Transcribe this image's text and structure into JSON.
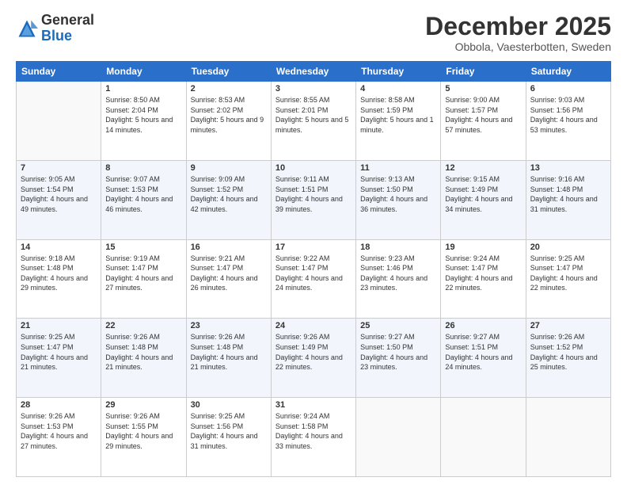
{
  "header": {
    "logo_general": "General",
    "logo_blue": "Blue",
    "month_title": "December 2025",
    "subtitle": "Obbola, Vaesterbotten, Sweden"
  },
  "days_of_week": [
    "Sunday",
    "Monday",
    "Tuesday",
    "Wednesday",
    "Thursday",
    "Friday",
    "Saturday"
  ],
  "weeks": [
    [
      {
        "day": "",
        "sunrise": "",
        "sunset": "",
        "daylight": ""
      },
      {
        "day": "1",
        "sunrise": "Sunrise: 8:50 AM",
        "sunset": "Sunset: 2:04 PM",
        "daylight": "Daylight: 5 hours and 14 minutes."
      },
      {
        "day": "2",
        "sunrise": "Sunrise: 8:53 AM",
        "sunset": "Sunset: 2:02 PM",
        "daylight": "Daylight: 5 hours and 9 minutes."
      },
      {
        "day": "3",
        "sunrise": "Sunrise: 8:55 AM",
        "sunset": "Sunset: 2:01 PM",
        "daylight": "Daylight: 5 hours and 5 minutes."
      },
      {
        "day": "4",
        "sunrise": "Sunrise: 8:58 AM",
        "sunset": "Sunset: 1:59 PM",
        "daylight": "Daylight: 5 hours and 1 minute."
      },
      {
        "day": "5",
        "sunrise": "Sunrise: 9:00 AM",
        "sunset": "Sunset: 1:57 PM",
        "daylight": "Daylight: 4 hours and 57 minutes."
      },
      {
        "day": "6",
        "sunrise": "Sunrise: 9:03 AM",
        "sunset": "Sunset: 1:56 PM",
        "daylight": "Daylight: 4 hours and 53 minutes."
      }
    ],
    [
      {
        "day": "7",
        "sunrise": "Sunrise: 9:05 AM",
        "sunset": "Sunset: 1:54 PM",
        "daylight": "Daylight: 4 hours and 49 minutes."
      },
      {
        "day": "8",
        "sunrise": "Sunrise: 9:07 AM",
        "sunset": "Sunset: 1:53 PM",
        "daylight": "Daylight: 4 hours and 46 minutes."
      },
      {
        "day": "9",
        "sunrise": "Sunrise: 9:09 AM",
        "sunset": "Sunset: 1:52 PM",
        "daylight": "Daylight: 4 hours and 42 minutes."
      },
      {
        "day": "10",
        "sunrise": "Sunrise: 9:11 AM",
        "sunset": "Sunset: 1:51 PM",
        "daylight": "Daylight: 4 hours and 39 minutes."
      },
      {
        "day": "11",
        "sunrise": "Sunrise: 9:13 AM",
        "sunset": "Sunset: 1:50 PM",
        "daylight": "Daylight: 4 hours and 36 minutes."
      },
      {
        "day": "12",
        "sunrise": "Sunrise: 9:15 AM",
        "sunset": "Sunset: 1:49 PM",
        "daylight": "Daylight: 4 hours and 34 minutes."
      },
      {
        "day": "13",
        "sunrise": "Sunrise: 9:16 AM",
        "sunset": "Sunset: 1:48 PM",
        "daylight": "Daylight: 4 hours and 31 minutes."
      }
    ],
    [
      {
        "day": "14",
        "sunrise": "Sunrise: 9:18 AM",
        "sunset": "Sunset: 1:48 PM",
        "daylight": "Daylight: 4 hours and 29 minutes."
      },
      {
        "day": "15",
        "sunrise": "Sunrise: 9:19 AM",
        "sunset": "Sunset: 1:47 PM",
        "daylight": "Daylight: 4 hours and 27 minutes."
      },
      {
        "day": "16",
        "sunrise": "Sunrise: 9:21 AM",
        "sunset": "Sunset: 1:47 PM",
        "daylight": "Daylight: 4 hours and 26 minutes."
      },
      {
        "day": "17",
        "sunrise": "Sunrise: 9:22 AM",
        "sunset": "Sunset: 1:47 PM",
        "daylight": "Daylight: 4 hours and 24 minutes."
      },
      {
        "day": "18",
        "sunrise": "Sunrise: 9:23 AM",
        "sunset": "Sunset: 1:46 PM",
        "daylight": "Daylight: 4 hours and 23 minutes."
      },
      {
        "day": "19",
        "sunrise": "Sunrise: 9:24 AM",
        "sunset": "Sunset: 1:47 PM",
        "daylight": "Daylight: 4 hours and 22 minutes."
      },
      {
        "day": "20",
        "sunrise": "Sunrise: 9:25 AM",
        "sunset": "Sunset: 1:47 PM",
        "daylight": "Daylight: 4 hours and 22 minutes."
      }
    ],
    [
      {
        "day": "21",
        "sunrise": "Sunrise: 9:25 AM",
        "sunset": "Sunset: 1:47 PM",
        "daylight": "Daylight: 4 hours and 21 minutes."
      },
      {
        "day": "22",
        "sunrise": "Sunrise: 9:26 AM",
        "sunset": "Sunset: 1:48 PM",
        "daylight": "Daylight: 4 hours and 21 minutes."
      },
      {
        "day": "23",
        "sunrise": "Sunrise: 9:26 AM",
        "sunset": "Sunset: 1:48 PM",
        "daylight": "Daylight: 4 hours and 21 minutes."
      },
      {
        "day": "24",
        "sunrise": "Sunrise: 9:26 AM",
        "sunset": "Sunset: 1:49 PM",
        "daylight": "Daylight: 4 hours and 22 minutes."
      },
      {
        "day": "25",
        "sunrise": "Sunrise: 9:27 AM",
        "sunset": "Sunset: 1:50 PM",
        "daylight": "Daylight: 4 hours and 23 minutes."
      },
      {
        "day": "26",
        "sunrise": "Sunrise: 9:27 AM",
        "sunset": "Sunset: 1:51 PM",
        "daylight": "Daylight: 4 hours and 24 minutes."
      },
      {
        "day": "27",
        "sunrise": "Sunrise: 9:26 AM",
        "sunset": "Sunset: 1:52 PM",
        "daylight": "Daylight: 4 hours and 25 minutes."
      }
    ],
    [
      {
        "day": "28",
        "sunrise": "Sunrise: 9:26 AM",
        "sunset": "Sunset: 1:53 PM",
        "daylight": "Daylight: 4 hours and 27 minutes."
      },
      {
        "day": "29",
        "sunrise": "Sunrise: 9:26 AM",
        "sunset": "Sunset: 1:55 PM",
        "daylight": "Daylight: 4 hours and 29 minutes."
      },
      {
        "day": "30",
        "sunrise": "Sunrise: 9:25 AM",
        "sunset": "Sunset: 1:56 PM",
        "daylight": "Daylight: 4 hours and 31 minutes."
      },
      {
        "day": "31",
        "sunrise": "Sunrise: 9:24 AM",
        "sunset": "Sunset: 1:58 PM",
        "daylight": "Daylight: 4 hours and 33 minutes."
      },
      {
        "day": "",
        "sunrise": "",
        "sunset": "",
        "daylight": ""
      },
      {
        "day": "",
        "sunrise": "",
        "sunset": "",
        "daylight": ""
      },
      {
        "day": "",
        "sunrise": "",
        "sunset": "",
        "daylight": ""
      }
    ]
  ]
}
